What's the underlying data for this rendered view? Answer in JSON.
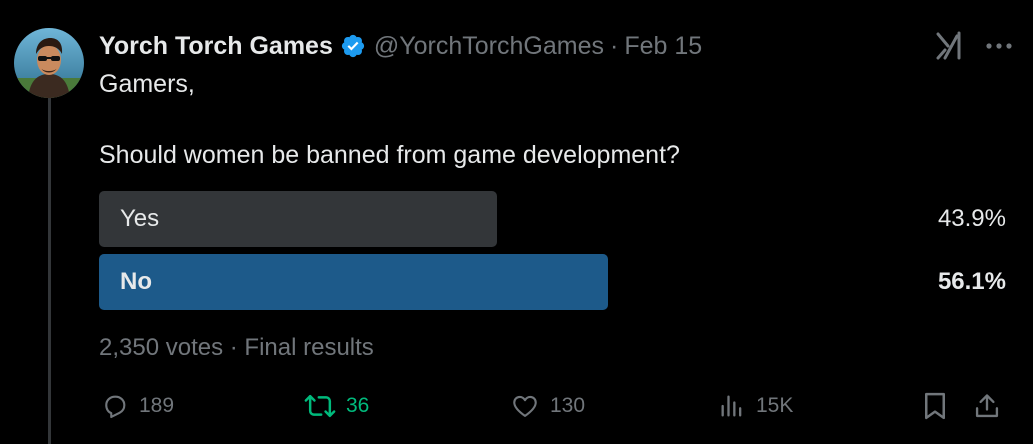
{
  "author": {
    "name": "Yorch Torch Games",
    "handle": "@YorchTorchGames",
    "separator": "·",
    "date": "Feb 15"
  },
  "tweet": {
    "line1": "Gamers,",
    "line2": "Should women be banned from game development?"
  },
  "poll": {
    "options": [
      {
        "label": "Yes",
        "percent_label": "43.9%",
        "percent": 43.9,
        "winner": false
      },
      {
        "label": "No",
        "percent_label": "56.1%",
        "percent": 56.1,
        "winner": true
      }
    ],
    "meta": "2,350 votes · Final results"
  },
  "actions": {
    "replies": "189",
    "reposts": "36",
    "likes": "130",
    "views": "15K"
  },
  "colors": {
    "background": "#000000",
    "text": "#e7e9ea",
    "muted": "#71767b",
    "verified": "#1d9bf0",
    "poll_loser": "#333639",
    "poll_winner": "#1d5a8a",
    "repost_active": "#00ba7c"
  },
  "icons": [
    "avatar",
    "verified-badge-icon",
    "grok-icon",
    "more-icon",
    "reply-icon",
    "repost-icon",
    "like-icon",
    "views-icon",
    "bookmark-icon",
    "share-icon"
  ]
}
